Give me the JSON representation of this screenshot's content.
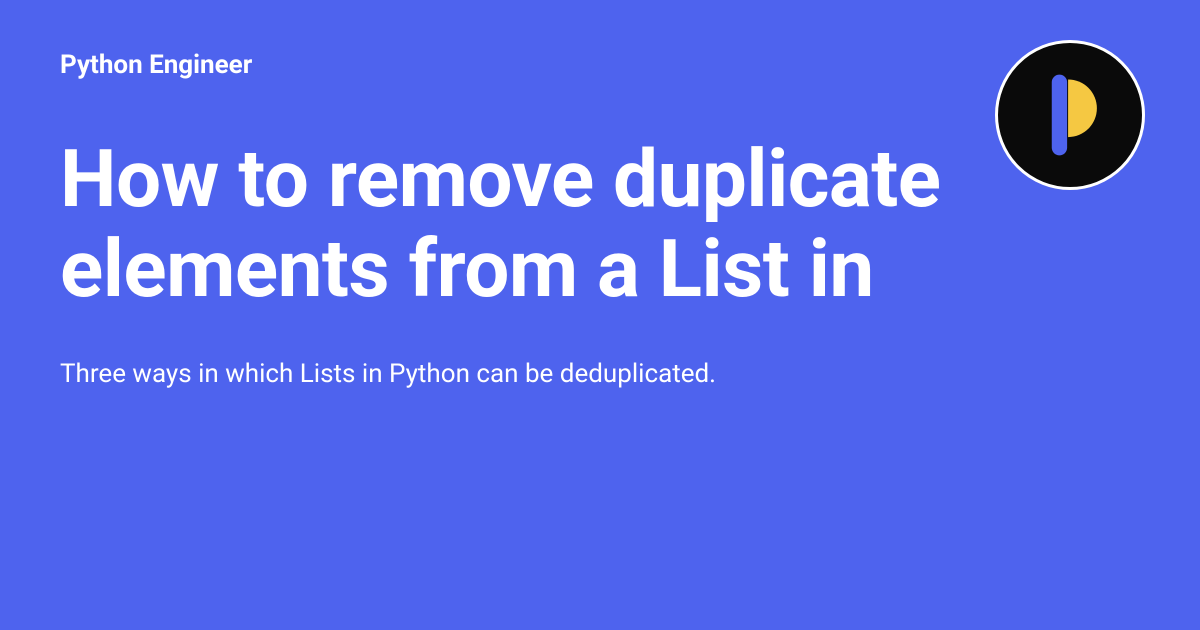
{
  "site_name": "Python Engineer",
  "title": "How to remove duplicate elements from a List in",
  "subtitle": "Three ways in which Lists in Python can be deduplicated.",
  "colors": {
    "background": "#4E63EE",
    "text": "#ffffff",
    "logo_bg": "#0a0a0a",
    "logo_accent_blue": "#4E63EE",
    "logo_accent_yellow": "#F5C842"
  }
}
